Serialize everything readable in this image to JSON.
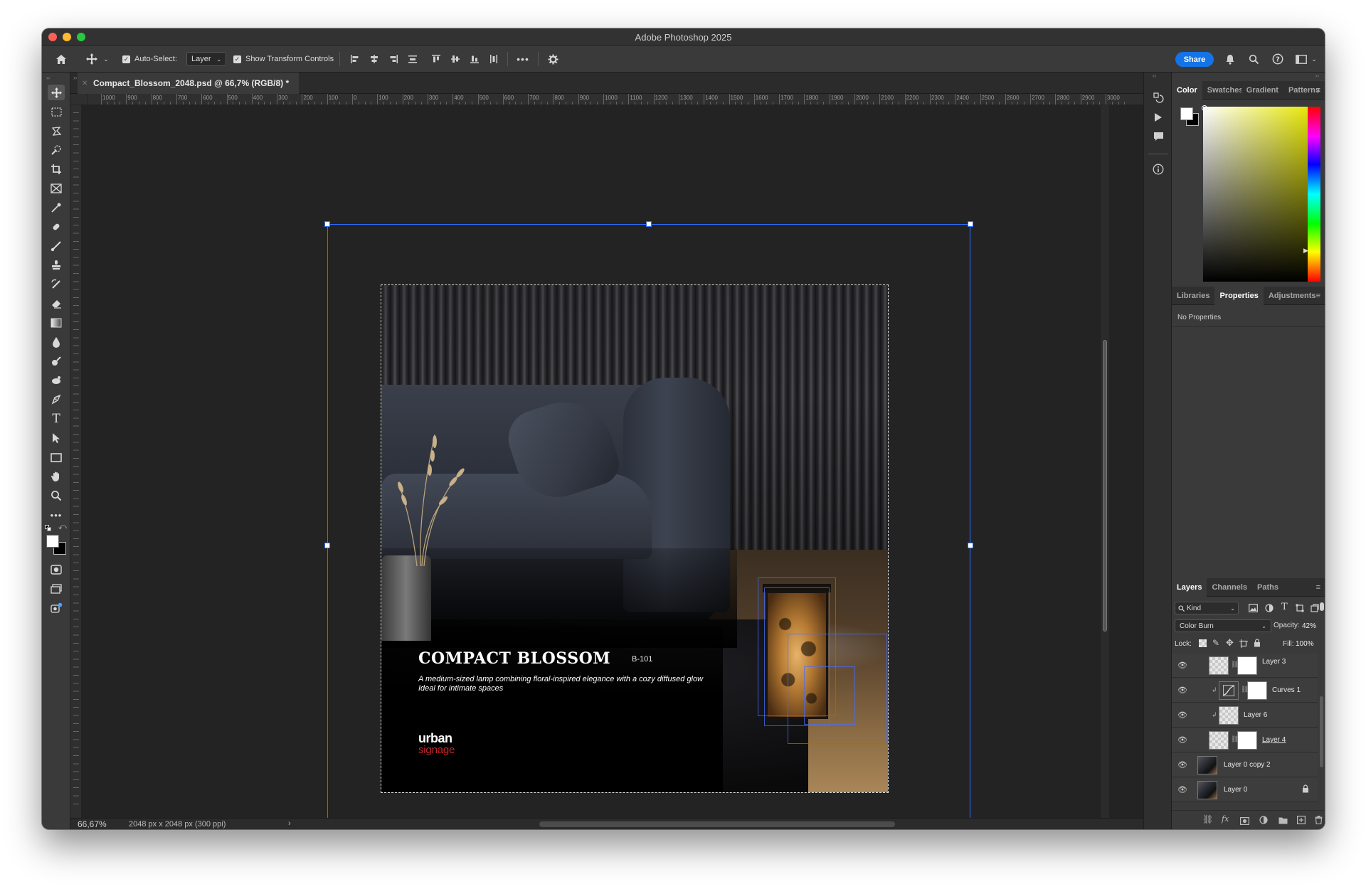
{
  "window": {
    "title": "Adobe Photoshop 2025"
  },
  "options_bar": {
    "auto_select_label": "Auto-Select:",
    "auto_select_checked": true,
    "auto_select_target": "Layer",
    "show_transform_label": "Show Transform Controls",
    "show_transform_checked": true,
    "share_label": "Share"
  },
  "document": {
    "tab_title": "Compact_Blossom_2048.psd @ 66,7% (RGB/8) *"
  },
  "ruler": {
    "h_labels": [
      "1000",
      "900",
      "800",
      "700",
      "600",
      "500",
      "400",
      "300",
      "200",
      "100",
      "0",
      "100",
      "200",
      "300",
      "400",
      "500",
      "600",
      "700",
      "800",
      "900",
      "1000",
      "1100",
      "1200",
      "1300",
      "1400",
      "1500",
      "1600",
      "1700",
      "1800",
      "1900",
      "2000",
      "2100",
      "2200",
      "2300",
      "2400",
      "2500",
      "2600",
      "2700",
      "2800",
      "2900",
      "3000"
    ]
  },
  "artwork": {
    "title": "COMPACT BLOSSOM",
    "code": "B-101",
    "description_line1": "A medium-sized lamp combining floral-inspired elegance with a cozy diffused glow",
    "description_line2": "Ideal for intimate spaces",
    "logo_top": "urban",
    "logo_bottom": "signage"
  },
  "status_bar": {
    "zoom": "66,67%",
    "doc_info": "2048 px x 2048 px (300 ppi)"
  },
  "color_panel": {
    "tabs": [
      "Color",
      "Swatches",
      "Gradient",
      "Patterns"
    ],
    "active_tab": "Color",
    "foreground": "#ffffff",
    "background": "#000000",
    "hue_color": "#e6e600"
  },
  "properties_panel": {
    "tabs": [
      "Libraries",
      "Properties",
      "Adjustments"
    ],
    "active_tab": "Properties",
    "empty_text": "No Properties"
  },
  "layers_panel": {
    "tabs": [
      "Layers",
      "Channels",
      "Paths"
    ],
    "active_tab": "Layers",
    "filter_kind": "Kind",
    "blend_mode": "Color Burn",
    "opacity_label": "Opacity:",
    "opacity_value": "42%",
    "lock_label": "Lock:",
    "fill_label": "Fill:",
    "fill_value": "100%",
    "layers": [
      {
        "name": "Layer 3"
      },
      {
        "name": "Curves 1"
      },
      {
        "name": "Layer 6"
      },
      {
        "name": "Layer 4"
      },
      {
        "name": "Layer 0 copy 2"
      },
      {
        "name": "Layer 0"
      }
    ]
  },
  "accent_color": "#1473e6"
}
